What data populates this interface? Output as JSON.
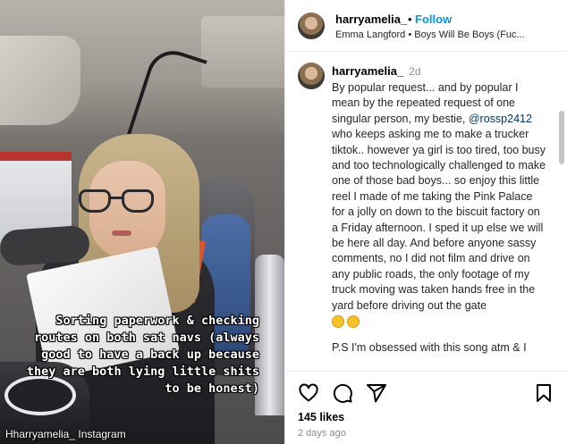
{
  "media": {
    "caption": "Sorting paperwork & checking routes on both sat navs (always good to have a back up because they are both lying little shits to be honest)",
    "watermark": "Hharryamelia_ Instagram"
  },
  "header": {
    "username": "harryamelia_",
    "separator": "•",
    "follow_label": "Follow",
    "audio": "Emma Langford • Boys Will Be Boys (Fuc..."
  },
  "comment": {
    "username": "harryamelia_",
    "time": "2d",
    "text_before": "By popular request... and by popular I mean by the repeated request of one singular person, my bestie, ",
    "mention": "@rossp2412",
    "text_after": " who keeps asking me to make a trucker tiktok.. however ya girl is too tired, too busy and too technologically challenged to make one of those bad boys... so enjoy this little reel I made of me taking the Pink Palace for a jolly on down to the biscuit factory on a Friday afternoon. I sped it up else we will be here all day. And before anyone sassy comments, no I did not film and drive on any public roads, the only footage of my truck moving was taken hands free in the yard before driving out the gate",
    "ps": "P.S I'm obsessed with this song atm & I"
  },
  "actions": {
    "icons": [
      "heart-icon",
      "comment-icon",
      "share-icon",
      "bookmark-icon"
    ],
    "likes": "145 likes",
    "time_ago": "2 days ago"
  },
  "colors": {
    "follow": "#0095f6",
    "mention": "#00376b",
    "muted": "#8e8e8e"
  }
}
